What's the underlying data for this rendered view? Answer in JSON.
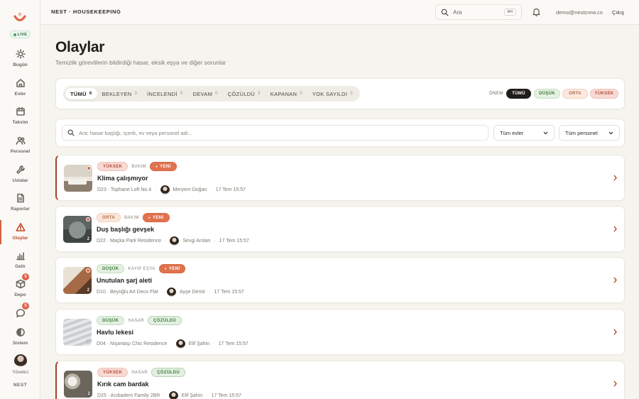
{
  "sidebar": {
    "live_label": "LIVE",
    "items": [
      {
        "label": "Bugün",
        "icon": "sun-icon"
      },
      {
        "label": "Evler",
        "icon": "house-icon"
      },
      {
        "label": "Takvim",
        "icon": "calendar-icon"
      },
      {
        "label": "Personel",
        "icon": "users-icon"
      },
      {
        "label": "Ustalar",
        "icon": "wrench-icon"
      },
      {
        "label": "Raporlar",
        "icon": "document-icon"
      },
      {
        "label": "Olaylar",
        "icon": "warning-icon",
        "active": true
      },
      {
        "label": "Gelir",
        "icon": "bar-chart-icon"
      },
      {
        "label": "Depo",
        "icon": "box-icon",
        "badge": "5"
      },
      {
        "label": "",
        "icon": "chat-icon",
        "badge": "5"
      },
      {
        "label": "Sistem",
        "icon": "half-circle-icon"
      }
    ],
    "admin_label": "Yönetici",
    "footer": "NEST"
  },
  "topbar": {
    "brand": "NEST · HOUSEKEEPING",
    "search_placeholder": "Ara",
    "shortcut": "⌘K",
    "email": "demo@nestcrew.co",
    "logout": "Çıkış"
  },
  "page": {
    "title": "Olaylar",
    "subtitle": "Temizlik görevlilerin bildirdiği hasar, eksik eşya ve diğer sorunlar"
  },
  "filters": {
    "tabs": [
      {
        "label": "TÜMÜ",
        "count": "6",
        "active": true
      },
      {
        "label": "BEKLEYEN",
        "count": "3"
      },
      {
        "label": "İNCELENDİ",
        "count": "0"
      },
      {
        "label": "DEVAM",
        "count": "0"
      },
      {
        "label": "ÇÖZÜLDÜ",
        "count": "3"
      },
      {
        "label": "KAPANAN",
        "count": "0"
      },
      {
        "label": "YOK SAYILDI",
        "count": "0"
      }
    ],
    "severity_label": "ÖNEM",
    "severity_all": "TÜMÜ",
    "severity_low": "DÜŞÜK",
    "severity_mid": "ORTA",
    "severity_high": "YÜKSEK"
  },
  "search": {
    "placeholder": "Ara: hasar başlığı, içerik, ev veya personel adı...",
    "home_select": "Tüm evler",
    "staff_select": "Tüm personel"
  },
  "incidents": [
    {
      "severity": "YÜKSEK",
      "category": "BAKIM",
      "status": "YENİ",
      "title": "Klima çalışmıyor",
      "location": "D23 · Tophane Loft No.4",
      "person": "Meryem Doğan",
      "time": "17 Tem 15:57"
    },
    {
      "severity": "ORTA",
      "category": "BAKIM",
      "status": "YENİ",
      "title": "Duş başlığı gevşek",
      "location": "D22 · Maçka Park Residence",
      "person": "Sevgi Arslan",
      "time": "17 Tem 15:57",
      "photo_count": "2"
    },
    {
      "severity": "DÜŞÜK",
      "category": "KAYIP EŞYA",
      "status": "YENİ",
      "title": "Unutulan şarj aleti",
      "location": "D10 · Beyoğlu Art Deco Flat",
      "person": "Ayşe Demir",
      "time": "17 Tem 15:57",
      "photo_count": "2"
    },
    {
      "severity": "DÜŞÜK",
      "category": "HASAR",
      "status": "ÇÖZÜLDÜ",
      "title": "Havlu lekesi",
      "location": "D04 · Nişantaşı Chic Residence",
      "person": "Elif Şahin",
      "time": "17 Tem 15:57",
      "photo_count": "2"
    },
    {
      "severity": "YÜKSEK",
      "category": "HASAR",
      "status": "ÇÖZÜLDÜ",
      "title": "Kırık cam bardak",
      "location": "D25 · Acıbadem Family 2BR",
      "person": "Elif Şahin",
      "time": "17 Tem 15:57",
      "photo_count": "2"
    }
  ]
}
